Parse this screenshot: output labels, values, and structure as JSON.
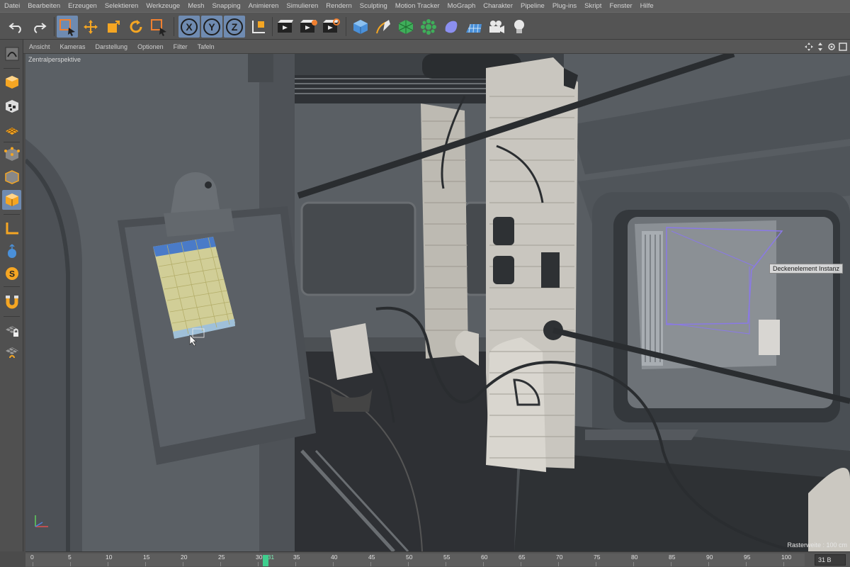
{
  "menubar": {
    "items": [
      "Datei",
      "Bearbeiten",
      "Erzeugen",
      "Selektieren",
      "Werkzeuge",
      "Mesh",
      "Snapping",
      "Animieren",
      "Simulieren",
      "Rendern",
      "Sculpting",
      "Motion Tracker",
      "MoGraph",
      "Charakter",
      "Pipeline",
      "Plug-ins",
      "Skript",
      "Fenster",
      "Hilfe"
    ]
  },
  "toolbar": {
    "axis_x": "X",
    "axis_y": "Y",
    "axis_z": "Z",
    "accent": "#6f8bb1",
    "icons": [
      "undo-icon",
      "redo-icon",
      "live-selection-icon",
      "move-icon",
      "scale-icon",
      "rotate-icon",
      "recent-tool-icon",
      "x-axis-lock",
      "y-axis-lock",
      "z-axis-lock",
      "coordinate-system-icon",
      "render-view-icon",
      "render-picture-viewer-icon",
      "render-settings-icon",
      "cube-icon",
      "pen-spline-icon",
      "subdivision-icon",
      "cloner-icon",
      "deformer-icon",
      "floor-icon",
      "camera-icon",
      "light-icon"
    ]
  },
  "viewport": {
    "menu": [
      "Ansicht",
      "Kameras",
      "Darstellung",
      "Optionen",
      "Filter",
      "Tafeln"
    ],
    "camera_label": "Zentralperspektive",
    "object_tooltip": "Deckenelement Instanz",
    "grid_spacing": "Rasterweite : 100 cm"
  },
  "timeline": {
    "ticks": [
      "0",
      "5",
      "10",
      "15",
      "20",
      "25",
      "30",
      "31",
      "35",
      "40",
      "45",
      "50",
      "55",
      "60",
      "65",
      "70",
      "75",
      "80",
      "85",
      "90",
      "95",
      "100"
    ],
    "current_frame": "31 B",
    "playhead_color": "#3fcf8e"
  }
}
